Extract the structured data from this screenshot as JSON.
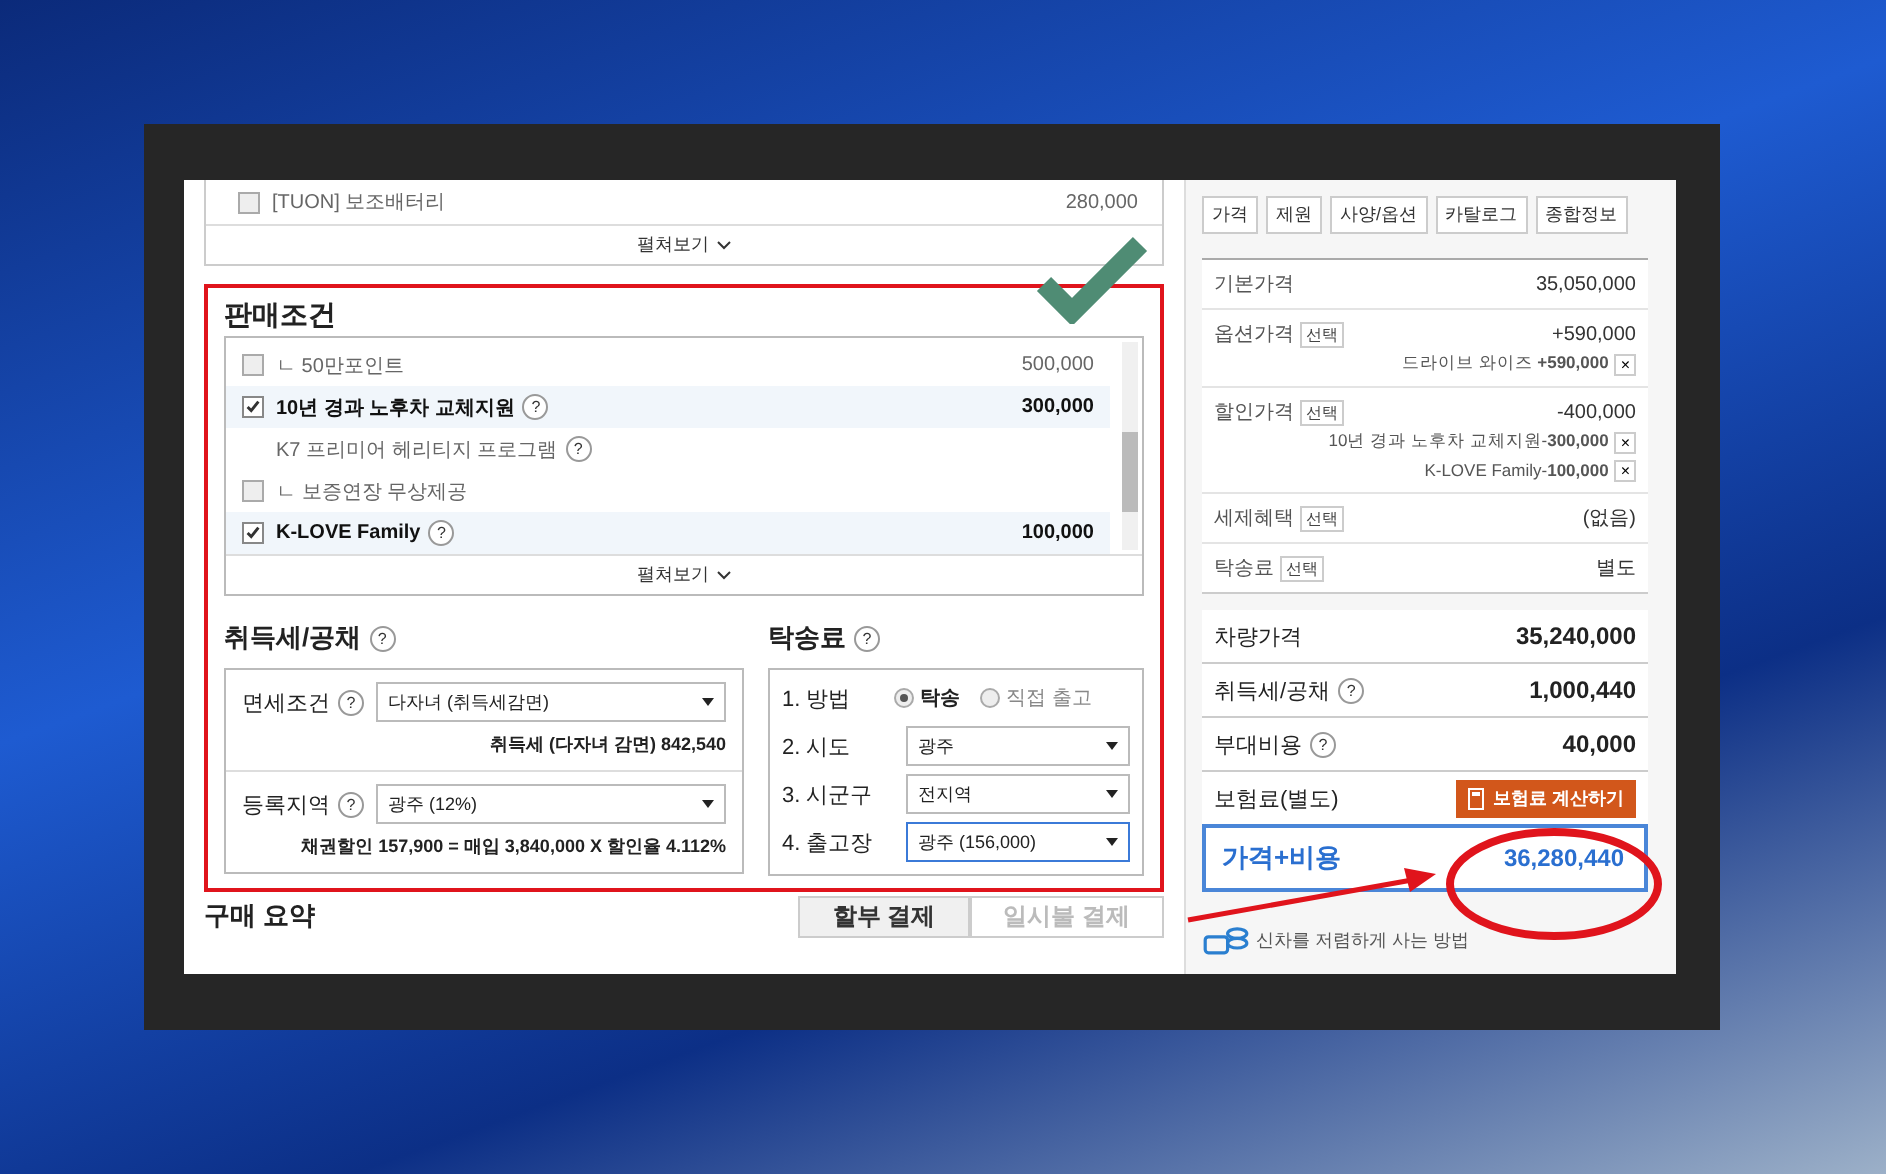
{
  "top_options": {
    "items": [
      {
        "label": "[TUON] 보조배터리",
        "value": "280,000",
        "checked": false
      }
    ],
    "expand": "펼쳐보기"
  },
  "sales_conditions": {
    "title": "판매조건",
    "items": [
      {
        "kind": "checkbox",
        "label": "ㄴ 50만포인트",
        "value": "500,000",
        "checked": false
      },
      {
        "kind": "checkbox",
        "label": "10년 경과 노후차 교체지원",
        "value": "300,000",
        "checked": true,
        "help": "?"
      },
      {
        "kind": "text",
        "label": "K7 프리미어 헤리티지 프로그램",
        "help": "?"
      },
      {
        "kind": "checkbox",
        "label": "ㄴ 보증연장 무상제공",
        "checked": false
      },
      {
        "kind": "checkbox",
        "label": "K-LOVE Family",
        "value": "100,000",
        "checked": true,
        "help": "?"
      }
    ],
    "expand": "펼쳐보기"
  },
  "tax": {
    "title": "취득세/공채",
    "help": "?",
    "fields": [
      {
        "label": "면세조건",
        "help": "?",
        "value": "다자녀 (취득세감면)",
        "note": "취득세 (다자녀 감면) 842,540"
      },
      {
        "label": "등록지역",
        "help": "?",
        "value": "광주 (12%)",
        "note": "채권할인 157,900 = 매입 3,840,000 X 할인율 4.112%"
      }
    ]
  },
  "delivery": {
    "title": "탁송료",
    "help": "?",
    "method_label": "1. 방법",
    "methods": [
      {
        "label": "탁송",
        "selected": true
      },
      {
        "label": "직접 출고",
        "selected": false
      }
    ],
    "selects": [
      {
        "label": "2. 시도",
        "value": "광주",
        "focused": false
      },
      {
        "label": "3. 시군구",
        "value": "전지역",
        "focused": false
      },
      {
        "label": "4. 출고장",
        "value": "광주 (156,000)",
        "focused": true
      }
    ]
  },
  "summary_title": "구매 요약",
  "pay_tabs": [
    {
      "label": "할부 결제",
      "selected": true
    },
    {
      "label": "일시불 결제",
      "selected": false
    }
  ],
  "right_tabs": [
    "가격",
    "제원",
    "사양/옵션",
    "카탈로그",
    "종합정보"
  ],
  "price_rows": [
    {
      "label": "기본가격",
      "value": "35,050,000"
    },
    {
      "label": "옵션가격",
      "select": "선택",
      "value": "+590,000",
      "details": [
        {
          "text": "드라이브 와이즈 ",
          "amount": "+590,000",
          "remove": "×"
        }
      ]
    },
    {
      "label": "할인가격",
      "select": "선택",
      "value": "-400,000",
      "details": [
        {
          "text": "10년 경과 노후차 교체지원-",
          "amount": "300,000",
          "remove": "×"
        },
        {
          "text": "K-LOVE Family-",
          "amount": "100,000",
          "remove": "×"
        }
      ]
    },
    {
      "label": "세제혜택",
      "select": "선택",
      "value": "(없음)"
    },
    {
      "label": "탁송료",
      "select": "선택",
      "value": "별도"
    }
  ],
  "totals": [
    {
      "label": "차량가격",
      "value": "35,240,000"
    },
    {
      "label": "취득세/공채",
      "help": "?",
      "value": "1,000,440"
    },
    {
      "label": "부대비용",
      "help": "?",
      "value": "40,000"
    }
  ],
  "insurance": {
    "label": "보험료(별도)",
    "button": "보험료 계산하기"
  },
  "grand_total": {
    "label": "가격+비용",
    "value": "36,280,440"
  },
  "promo": "신차를 저렴하게 사는 방법"
}
